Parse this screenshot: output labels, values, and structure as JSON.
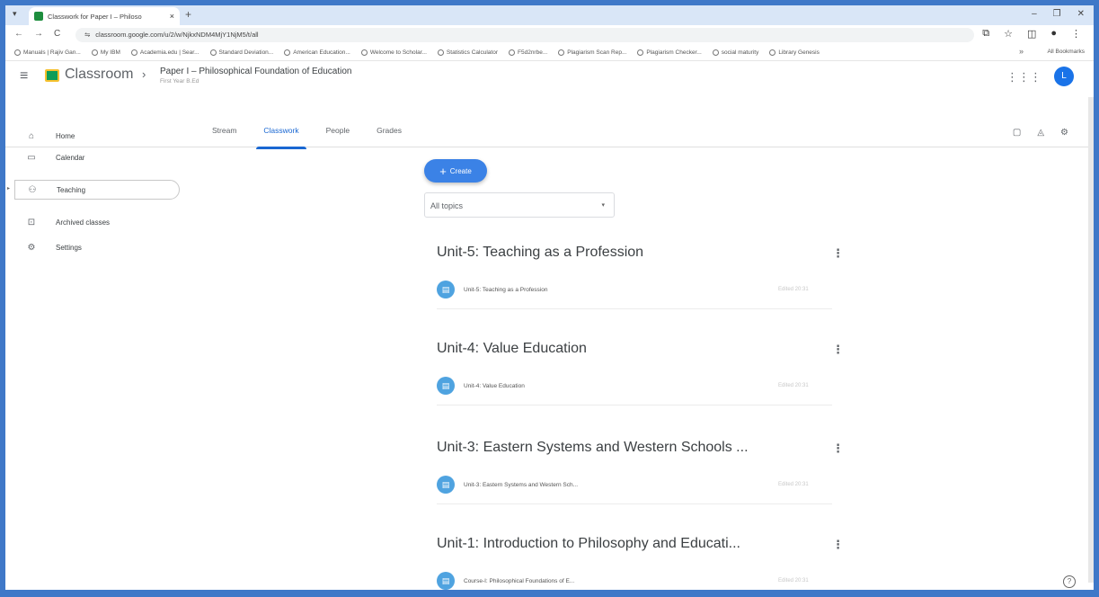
{
  "browser": {
    "tab_title": "Classwork for Paper I – Philoso",
    "tab_close": "×",
    "new_tab": "+",
    "url": "classroom.google.com/u/2/w/NjkxNDM4MjY1NjM5/t/all",
    "bookmarks": [
      "Manuals | Rajiv Gan...",
      "My IBM",
      "Academia.edu | Sear...",
      "Standard Deviation...",
      "American Education...",
      "Welcome to Scholar...",
      "Statistics Calculator",
      "F5d2nrbe...",
      "Plagiarism Scan Rep...",
      "Plagiarism Checker...",
      "social maturity",
      "Library Genesis"
    ],
    "bookmarks_overflow": "»",
    "all_bookmarks": "All Bookmarks"
  },
  "header": {
    "brand": "Classroom",
    "separator": "›",
    "course_title": "Paper I – Philosophical Foundation of Education",
    "course_subtitle": "First Year B.Ed",
    "avatar_letter": "L"
  },
  "tabs": [
    {
      "label": "Stream"
    },
    {
      "label": "Classwork"
    },
    {
      "label": "People"
    },
    {
      "label": "Grades"
    }
  ],
  "sidebar": {
    "items": [
      {
        "label": "Home",
        "icon": "home-icon"
      },
      {
        "label": "Calendar",
        "icon": "calendar-icon"
      },
      {
        "label": "Teaching",
        "icon": "people-icon"
      },
      {
        "label": "Archived classes",
        "icon": "archive-icon"
      },
      {
        "label": "Settings",
        "icon": "gear-icon"
      }
    ]
  },
  "main": {
    "create_label": "Create",
    "topics_filter": "All topics",
    "topics": [
      {
        "title": "Unit-5: Teaching as a Profession",
        "item": "Unit-5: Teaching as a Profession",
        "edited": "Edited 20:31"
      },
      {
        "title": "Unit-4: Value Education",
        "item": "Unit-4: Value Education",
        "edited": "Edited 20:31"
      },
      {
        "title": "Unit-3: Eastern Systems and Western Schools ...",
        "item": "Unit-3: Eastern Systems and Western Sch...",
        "edited": "Edited 20:31"
      },
      {
        "title": "Unit-1: Introduction to Philosophy and Educati...",
        "item": "Course-I: Philosophical Foundations of E...",
        "edited": "Edited 20:31"
      }
    ]
  },
  "colors": {
    "accent": "#1967d2",
    "create_button": "#3b82e6",
    "frame": "#3f78c8"
  }
}
